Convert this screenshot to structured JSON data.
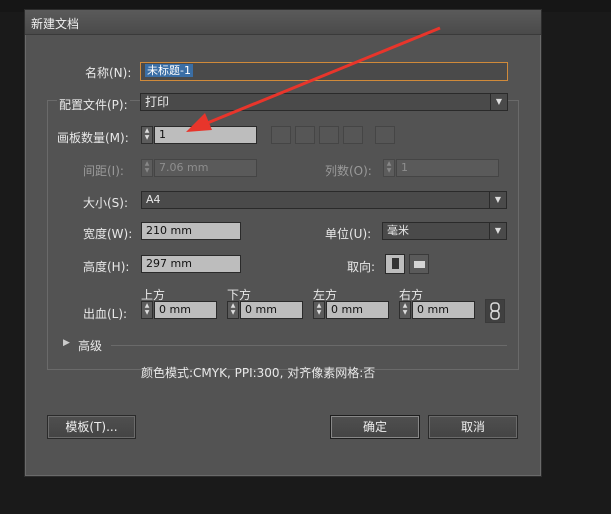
{
  "dialog": {
    "title": "新建文档"
  },
  "name": {
    "label": "名称(N):",
    "value": "未标题-1"
  },
  "profile": {
    "label": "配置文件(P):",
    "value": "打印"
  },
  "artboards": {
    "label": "画板数量(M):",
    "value": "1"
  },
  "spacing": {
    "label": "间距(I):",
    "value": "7.06 mm"
  },
  "columns": {
    "label": "列数(O):",
    "value": "1"
  },
  "size": {
    "label": "大小(S):",
    "value": "A4"
  },
  "width": {
    "label": "宽度(W):",
    "value": "210 mm"
  },
  "units": {
    "label": "单位(U):",
    "value": "毫米"
  },
  "height": {
    "label": "高度(H):",
    "value": "297 mm"
  },
  "orientation": {
    "label": "取向:"
  },
  "bleed": {
    "label": "出血(L):",
    "top": {
      "label": "上方",
      "value": "0 mm"
    },
    "bottom": {
      "label": "下方",
      "value": "0 mm"
    },
    "left": {
      "label": "左方",
      "value": "0 mm"
    },
    "right": {
      "label": "右方",
      "value": "0 mm"
    }
  },
  "advanced": {
    "label": "高级"
  },
  "info": {
    "text": "颜色模式:CMYK, PPI:300, 对齐像素网格:否"
  },
  "buttons": {
    "templates": "模板(T)...",
    "ok": "确定",
    "cancel": "取消"
  },
  "colors": {
    "dialog_bg": "#535353",
    "field_bg": "#3c3c3c",
    "highlight": "#3a6ea5",
    "arrow": "#e8352b"
  }
}
